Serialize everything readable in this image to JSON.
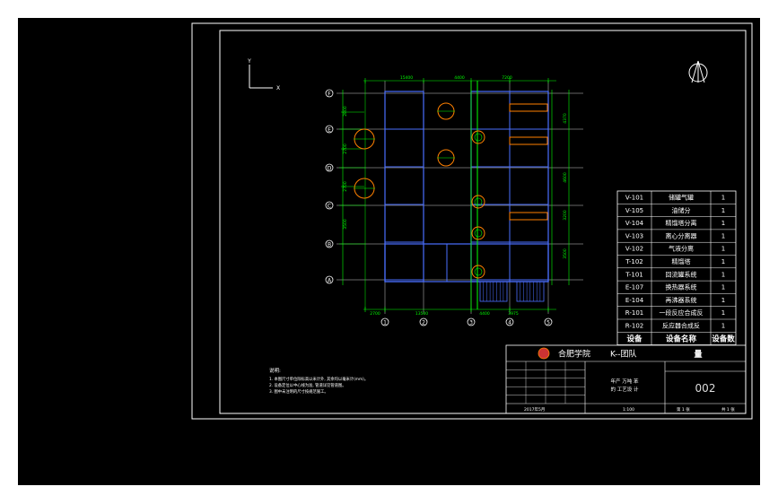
{
  "equipment_table": {
    "rows": [
      {
        "code": "V-101",
        "name": "储罐气罐",
        "qty": "1"
      },
      {
        "code": "V-105",
        "name": "油储分",
        "qty": "1"
      },
      {
        "code": "V-104",
        "name": "精馏塔分离",
        "qty": "1"
      },
      {
        "code": "V-103",
        "name": "离心分离器",
        "qty": "1"
      },
      {
        "code": "V-102",
        "name": "气液分离",
        "qty": "1"
      },
      {
        "code": "T-102",
        "name": "精馏塔",
        "qty": "1"
      },
      {
        "code": "T-101",
        "name": "回流罐系统",
        "qty": "1"
      },
      {
        "code": "E-107",
        "name": "换热器系统",
        "qty": "1"
      },
      {
        "code": "E-104",
        "name": "再沸器系统",
        "qty": "1"
      },
      {
        "code": "R-101",
        "name": "一段反应合成反",
        "qty": "1"
      },
      {
        "code": "R-102",
        "name": "反应器合成反",
        "qty": "1"
      }
    ],
    "header": {
      "code": "设备",
      "name": "设备名称",
      "qty": "设备数"
    },
    "extra_header": "量"
  },
  "title_block": {
    "school": "合肥学院",
    "team": "K--团队",
    "drawing_no": "002",
    "project_line1": "年产 万吨 苯",
    "project_line2": "的 工艺设 计",
    "date": "2017年5月",
    "sheet": "第 1 张",
    "total": "共 1 张",
    "scale": "1:100"
  },
  "grid": {
    "rows": [
      "F",
      "E",
      "D",
      "C",
      "B",
      "A"
    ],
    "cols": [
      "1",
      "2",
      "3",
      "4",
      "5"
    ],
    "top_dims": [
      "15400",
      "4400",
      "7200"
    ],
    "bottom_dims": [
      "2700",
      "13500",
      "4400",
      "3975"
    ],
    "left_dims": [
      "2800",
      "2700",
      "2700",
      "3500"
    ],
    "right_dims": [
      "4370",
      "4600",
      "3200",
      "3500"
    ]
  },
  "notes": {
    "title": "说明:",
    "lines": [
      "1. 本图尺寸单位除标高以米计外, 其余均以毫米计(mm)。",
      "2. 设备定位以中心线为准, 管道详见管道图。",
      "3. 图中未注明的尺寸按规范施工。"
    ]
  },
  "axis": {
    "x": "X",
    "y": "Y"
  },
  "colors": {
    "background": "#000000",
    "frame": "#ffffff",
    "grid": "#4a6fff",
    "dim": "#00ff00",
    "equipment": "#ff8000",
    "axis_bubble": "#ffffff"
  }
}
